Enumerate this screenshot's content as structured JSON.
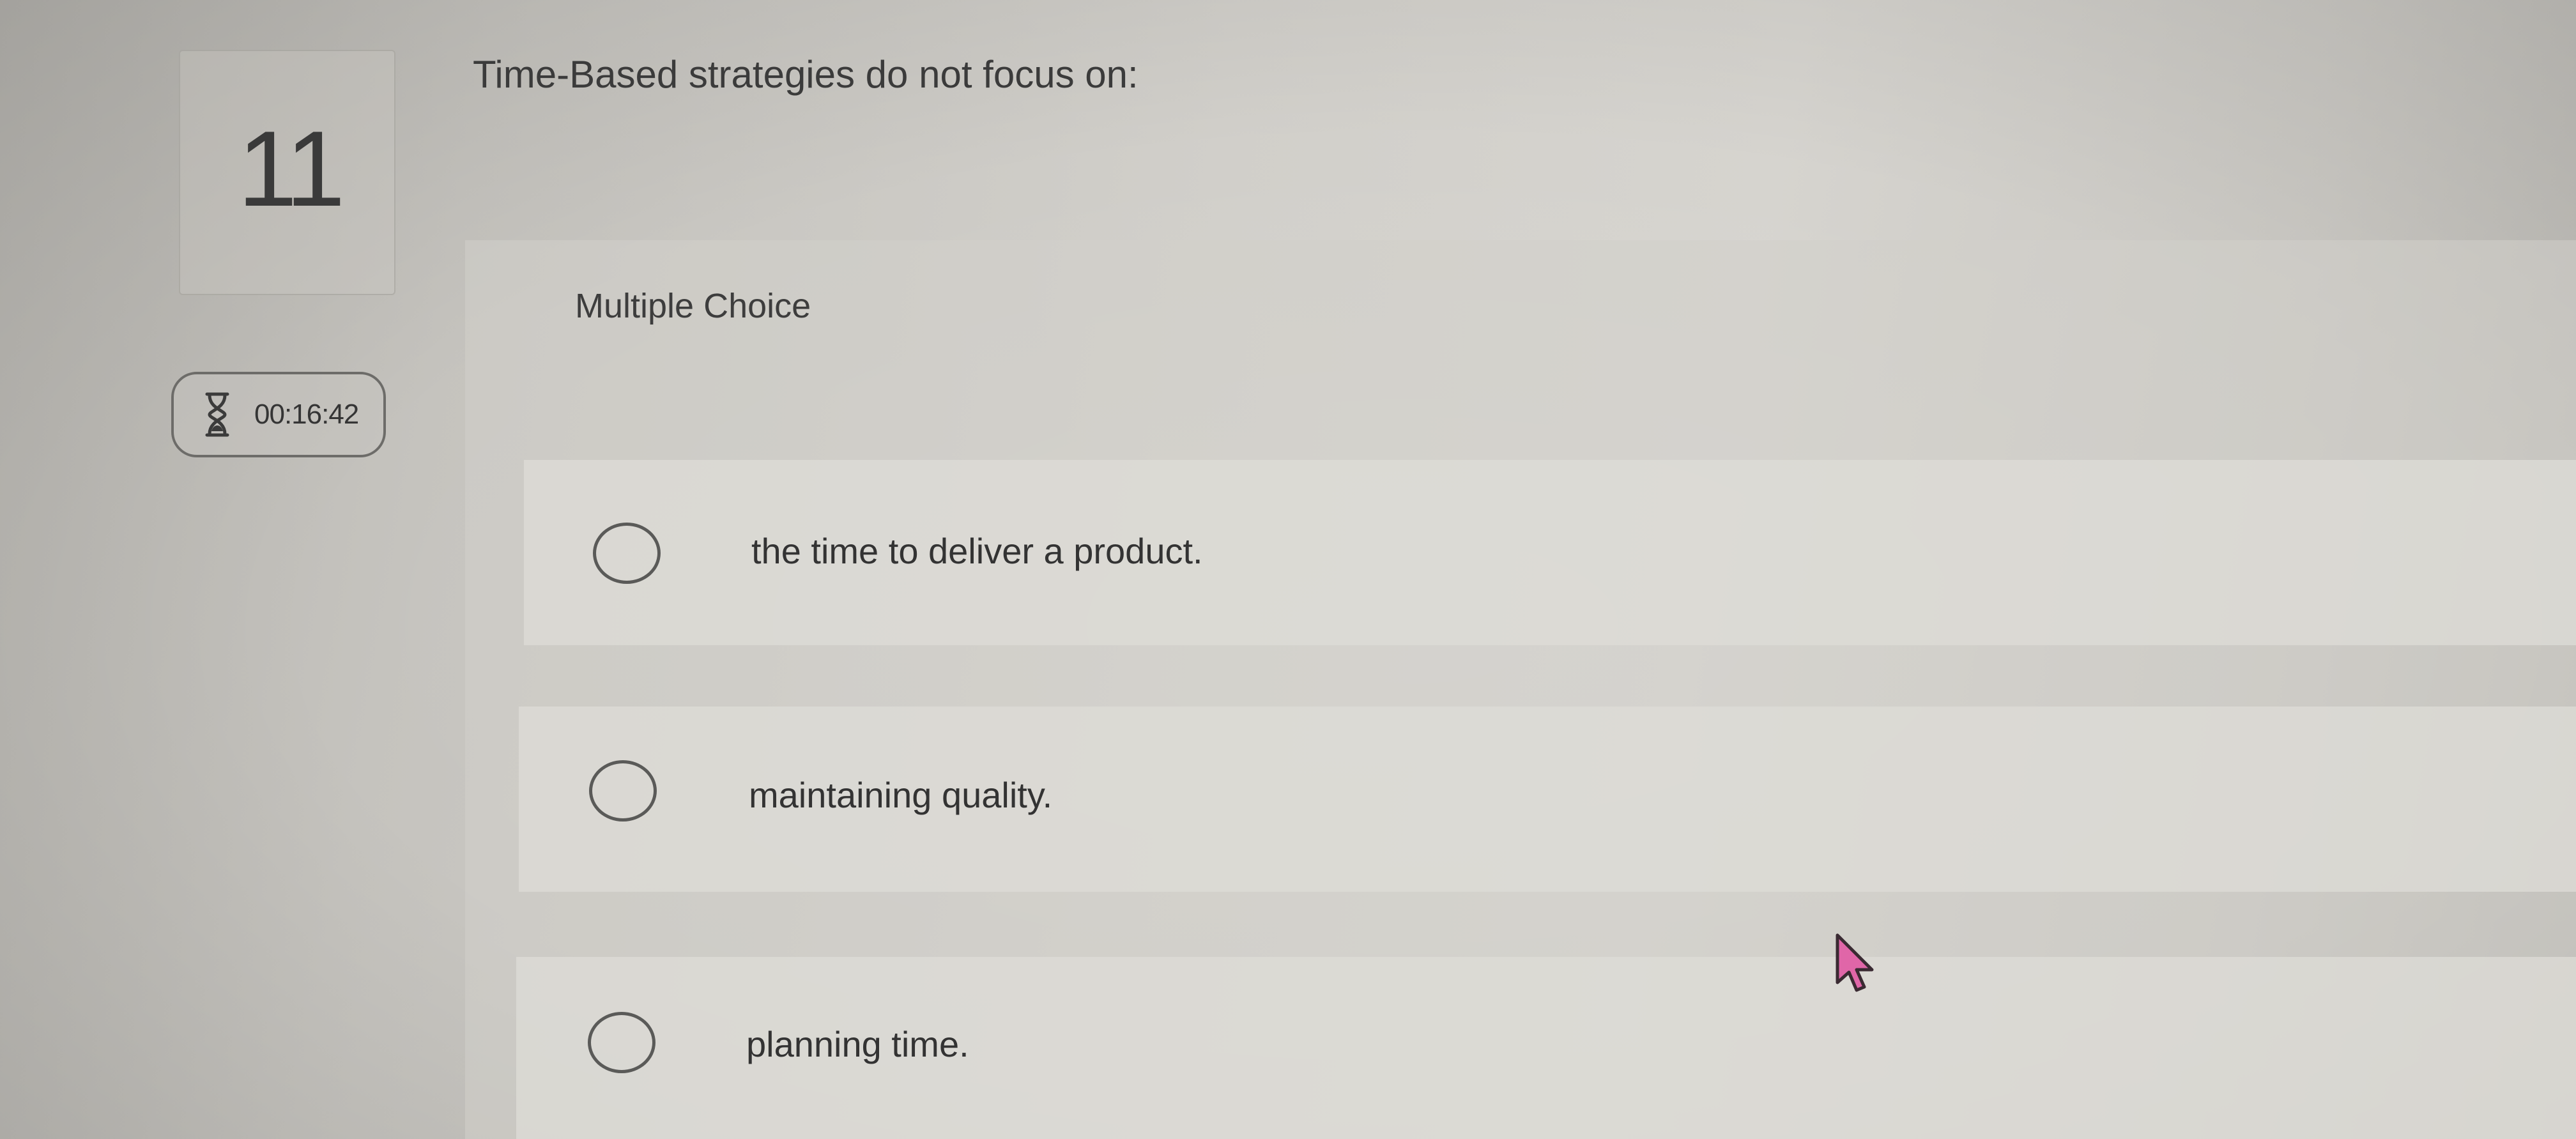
{
  "question": {
    "number": "11",
    "text": "Time-Based strategies do not focus on:",
    "type_label": "Multiple Choice"
  },
  "timer": {
    "icon": "hourglass-icon",
    "value": "00:16:42"
  },
  "options": [
    {
      "label": "the time to deliver a product.",
      "selected": false
    },
    {
      "label": "maintaining quality.",
      "selected": false
    },
    {
      "label": "planning time.",
      "selected": false
    }
  ],
  "cursor": {
    "icon": "mouse-pointer-icon",
    "color": "#e066a8"
  }
}
